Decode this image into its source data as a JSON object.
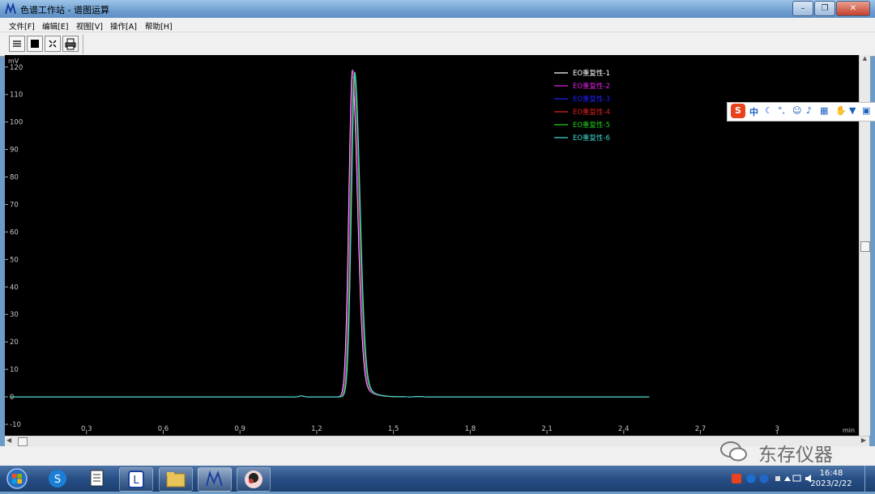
{
  "window": {
    "title": "色谱工作站 - 谱图运算"
  },
  "menu": [
    "文件[F]",
    "编辑[E]",
    "视图[V]",
    "操作[A]",
    "帮助[H]"
  ],
  "toolbar": {
    "icons": [
      "list-icon",
      "stop-square-icon",
      "fit-zoom-icon",
      "print-icon"
    ]
  },
  "chart_data": {
    "type": "line",
    "ylabel": "mV",
    "xlabel": "min",
    "xlim": [
      0,
      3.3
    ],
    "ylim": [
      -10,
      122
    ],
    "xticks": [
      0.3,
      0.6,
      0.9,
      1.2,
      1.5,
      1.8,
      2.1,
      2.4,
      2.7,
      3
    ],
    "yticks": [
      -10,
      0,
      10,
      20,
      30,
      40,
      50,
      60,
      70,
      80,
      90,
      100,
      110,
      120
    ],
    "xtick_labels": [
      "0.3",
      "0.6",
      "0.9",
      "1.2",
      "1.5",
      "1.8",
      "2.1",
      "2.4",
      "2.7",
      "3"
    ],
    "ytick_labels": [
      "-10",
      "0",
      "10",
      "20",
      "30",
      "40",
      "50",
      "60",
      "70",
      "80",
      "90",
      "100",
      "110",
      "120"
    ],
    "peak": {
      "time": 1.34,
      "height": 119,
      "sigma_left": 0.014,
      "sigma_right": 0.02,
      "tail": 0.03
    },
    "x_end": 2.5,
    "grid": false,
    "legend_position": "top-right",
    "series": [
      {
        "name": "EO重复性-1",
        "color": "#ffffff"
      },
      {
        "name": "EO重复性-2",
        "color": "#e020e0"
      },
      {
        "name": "EO重复性-3",
        "color": "#2020ff"
      },
      {
        "name": "EO重复性-4",
        "color": "#e02020"
      },
      {
        "name": "EO重复性-5",
        "color": "#20d020"
      },
      {
        "name": "EO重复性-6",
        "color": "#40d8d0"
      }
    ]
  },
  "ime": {
    "logo": "S",
    "mode": "中",
    "icons": [
      "moon-icon",
      "punctuation-icon",
      "smile-icon",
      "mic-icon",
      "keyboard-icon",
      "hand-icon",
      "shirt-icon",
      "grid-icon"
    ]
  },
  "taskbar": {
    "apps": [
      "start-orb-icon",
      "sogou-browser-icon",
      "notepad-icon",
      "lock-app-icon",
      "folder-icon",
      "chromatography-app-icon",
      "avatar-app-icon"
    ],
    "clock_time": "16:48",
    "clock_date": "2023/2/22"
  },
  "watermark": {
    "text": "东存仪器"
  }
}
